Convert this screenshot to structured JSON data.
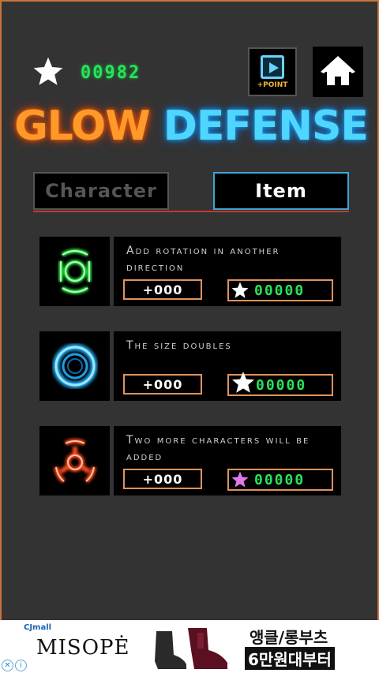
{
  "header": {
    "score": "00982",
    "video_button_label": "+POINT"
  },
  "title": {
    "part1": "GLOW",
    "part2": "DEFENSE"
  },
  "tabs": [
    {
      "label": "Character",
      "active": false
    },
    {
      "label": "Item",
      "active": true
    }
  ],
  "items": [
    {
      "icon": "green-rotation-icon",
      "description": "Add rotation in another direction",
      "count": "+000",
      "price": "00000",
      "price_star_color": "#ffffff"
    },
    {
      "icon": "blue-ring-icon",
      "description": "The size doubles",
      "count": "+000",
      "price": "00000",
      "price_star_color": "#ffffff"
    },
    {
      "icon": "red-triple-icon",
      "description": "Two more characters will be added",
      "count": "+000",
      "price": "00000",
      "price_star_color": "#e07ae8"
    }
  ],
  "ad": {
    "network": "CJmall",
    "brand": "MISOPĖ",
    "line1": "앵클/롱부츠",
    "line2": "6만원대부터"
  },
  "colors": {
    "accent_green": "#27e35a",
    "title_orange": "#ff9a2a",
    "title_blue": "#4fd6ff",
    "border_orange": "#e0935a"
  }
}
